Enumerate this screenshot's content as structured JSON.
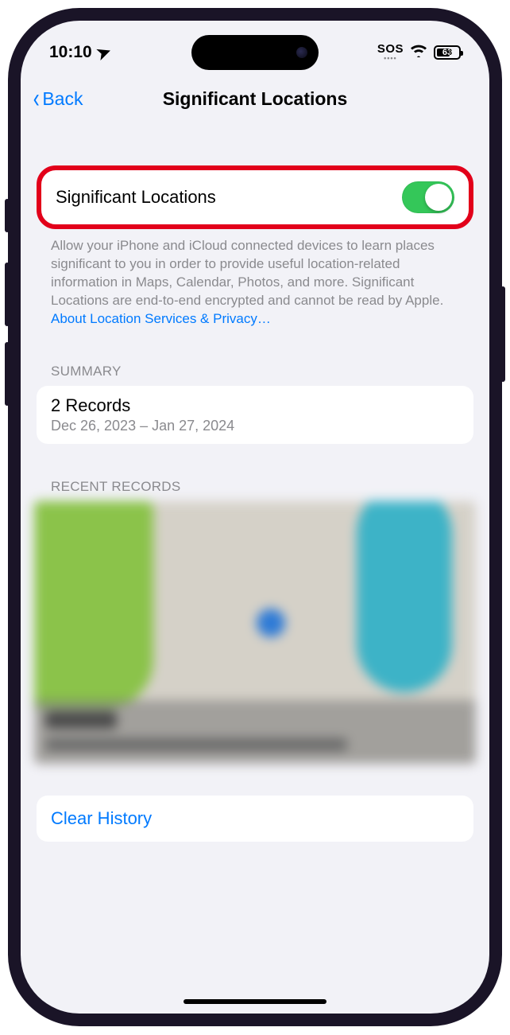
{
  "status": {
    "time": "10:10",
    "location_icon": "➤",
    "sos": "SOS",
    "battery_pct": "63"
  },
  "nav": {
    "back": "Back",
    "title": "Significant Locations"
  },
  "toggle": {
    "label": "Significant Locations",
    "on": true
  },
  "description": "Allow your iPhone and iCloud connected devices to learn places significant to you in order to provide useful location-related information in Maps, Calendar, Photos, and more. Significant Locations are end-to-end encrypted and cannot be read by Apple.",
  "privacy_link": "About Location Services & Privacy…",
  "summary": {
    "header": "SUMMARY",
    "title": "2 Records",
    "range": "Dec 26, 2023 – Jan 27, 2024"
  },
  "records": {
    "header": "RECENT RECORDS"
  },
  "clear": {
    "label": "Clear History"
  },
  "colors": {
    "accent": "#007aff",
    "toggle_on": "#34c759",
    "highlight": "#e2001a"
  }
}
